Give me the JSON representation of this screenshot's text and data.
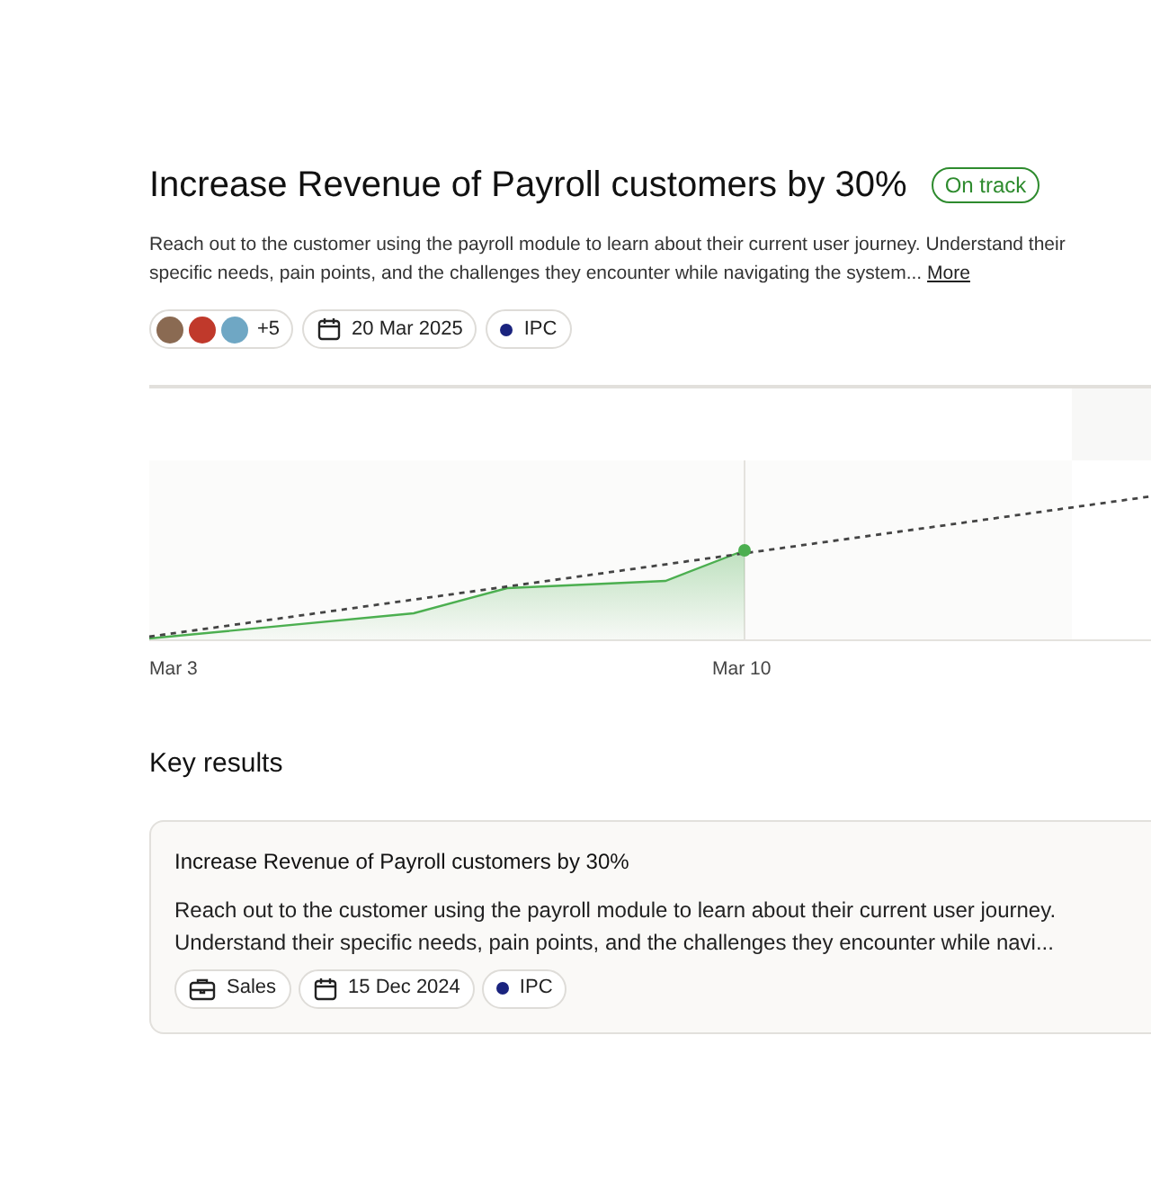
{
  "goal": {
    "title": "Increase Revenue of Payroll customers by 30%",
    "status": {
      "label": "On track",
      "color": "#2e8b2e"
    },
    "description": "Reach out to the customer using the payroll module to learn about their current user journey. Understand their specific needs, pain points, and the challenges they encounter while navigating the system...",
    "more_link": "More",
    "owners": {
      "avatars": [
        {
          "color": "#8a6a52"
        },
        {
          "color": "#c0392b"
        },
        {
          "color": "#6fa7c4"
        }
      ],
      "extra": "+5"
    },
    "due_date": "20 Mar 2025",
    "team": {
      "label": "IPC",
      "color": "#1a237e"
    }
  },
  "progress_chart": {
    "x_labels": [
      "Mar 3",
      "Mar 10"
    ]
  },
  "key_results": {
    "heading": "Key results",
    "items": [
      {
        "title": "Increase Revenue of Payroll customers by 30%",
        "description": "Reach out to the customer using the payroll module to learn about their current user journey. Understand their specific needs, pain points, and the challenges they encounter while navi...",
        "department": "Sales",
        "date": "15 Dec 2024",
        "team": {
          "label": "IPC",
          "color": "#1a237e"
        }
      }
    ]
  }
}
